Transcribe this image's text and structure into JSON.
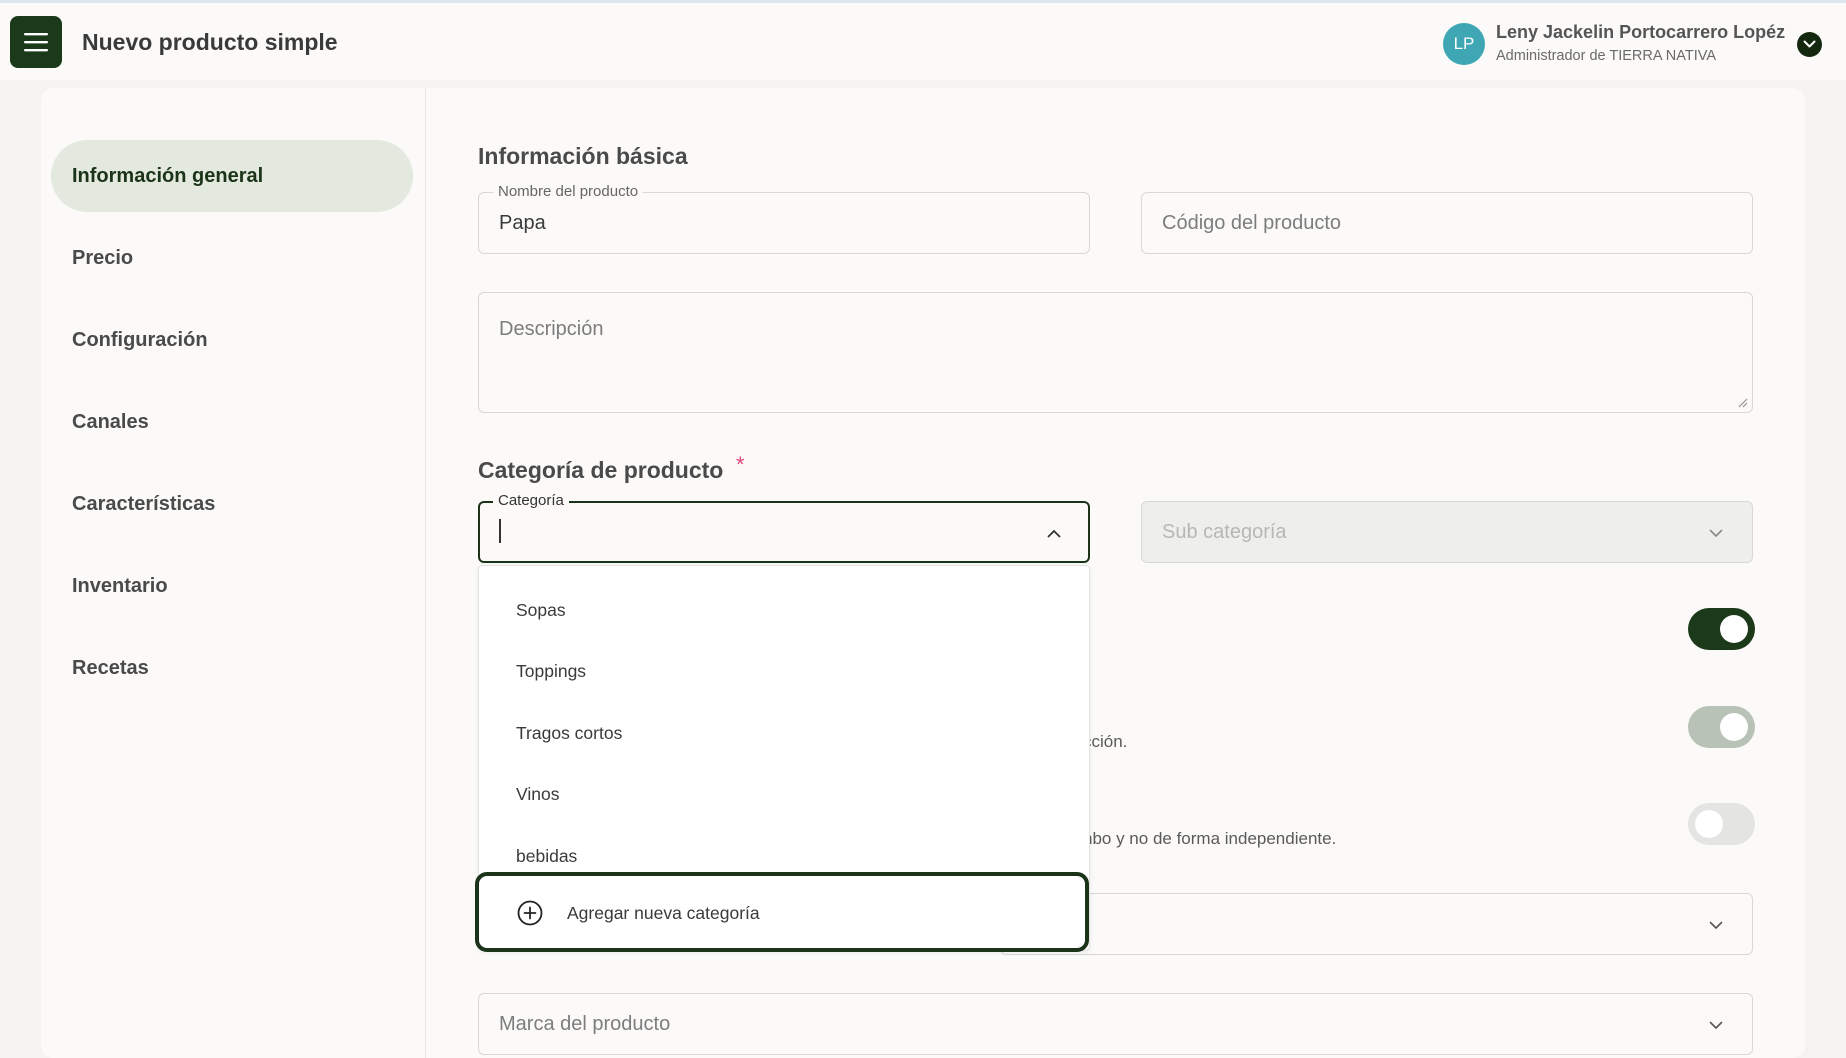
{
  "header": {
    "title": "Nuevo producto simple",
    "menu_icon": "hamburger-menu-icon",
    "user": {
      "initials": "LP",
      "name": "Leny Jackelin Portocarrero Lopéz",
      "role": "Administrador de TIERRA NATIVA",
      "avatar_color": "#3fa7b3"
    }
  },
  "sidebar": {
    "items": [
      {
        "label": "Información general",
        "active": true
      },
      {
        "label": "Precio"
      },
      {
        "label": "Configuración"
      },
      {
        "label": "Canales"
      },
      {
        "label": "Características"
      },
      {
        "label": "Inventario"
      },
      {
        "label": "Recetas"
      }
    ]
  },
  "basic_info": {
    "title": "Información básica",
    "product_name": {
      "label": "Nombre del producto",
      "value": "Papa"
    },
    "product_code": {
      "placeholder": "Código del producto",
      "value": ""
    },
    "description": {
      "placeholder": "Descripción",
      "value": ""
    }
  },
  "category": {
    "title": "Categoría de producto",
    "required_mark": "*",
    "category_field": {
      "label": "Categoría",
      "value": ""
    },
    "subcategory_field": {
      "placeholder": "Sub categoría",
      "disabled": true
    },
    "options": [
      "Sopas",
      "Toppings",
      "Tragos cortos",
      "Vinos",
      "bebidas"
    ],
    "add_new": "Agregar nueva categoría"
  },
  "partially_hidden": {
    "text_1": "cción.",
    "text_2": "nbo y no de forma independiente."
  },
  "toggles": [
    {
      "state": "on"
    },
    {
      "state": "on",
      "muted": true
    },
    {
      "state": "off"
    }
  ],
  "brand": {
    "placeholder": "Marca del producto"
  },
  "colors": {
    "primary": "#1c3a1a",
    "active_nav_bg": "#e3e9df",
    "required": "#e0457b",
    "background": "#f4f3ef"
  }
}
